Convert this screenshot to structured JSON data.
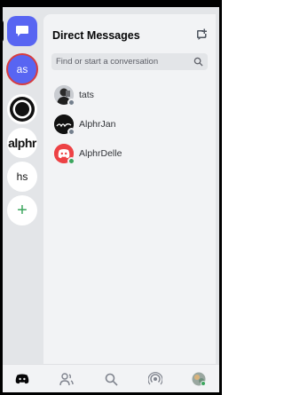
{
  "rail": {
    "servers": [
      {
        "label": "as"
      },
      {
        "label": "alphr"
      },
      {
        "label": "hs"
      },
      {
        "label": "+"
      }
    ]
  },
  "panel": {
    "title": "Direct Messages",
    "search_placeholder": "Find or start a conversation"
  },
  "dms": [
    {
      "name": "tats",
      "status": "offline"
    },
    {
      "name": "AlphrJan",
      "status": "offline"
    },
    {
      "name": "AlphrDelle",
      "status": "online"
    }
  ],
  "colors": {
    "accent": "#5865f2",
    "online": "#3ba55d",
    "offline": "#747f8d",
    "highlight_border": "#d83c3e",
    "delle_avatar": "#ed4245"
  },
  "nav": {
    "icons": [
      "discord-icon",
      "friends-icon",
      "search-icon",
      "mentions-icon",
      "profile-icon"
    ]
  }
}
